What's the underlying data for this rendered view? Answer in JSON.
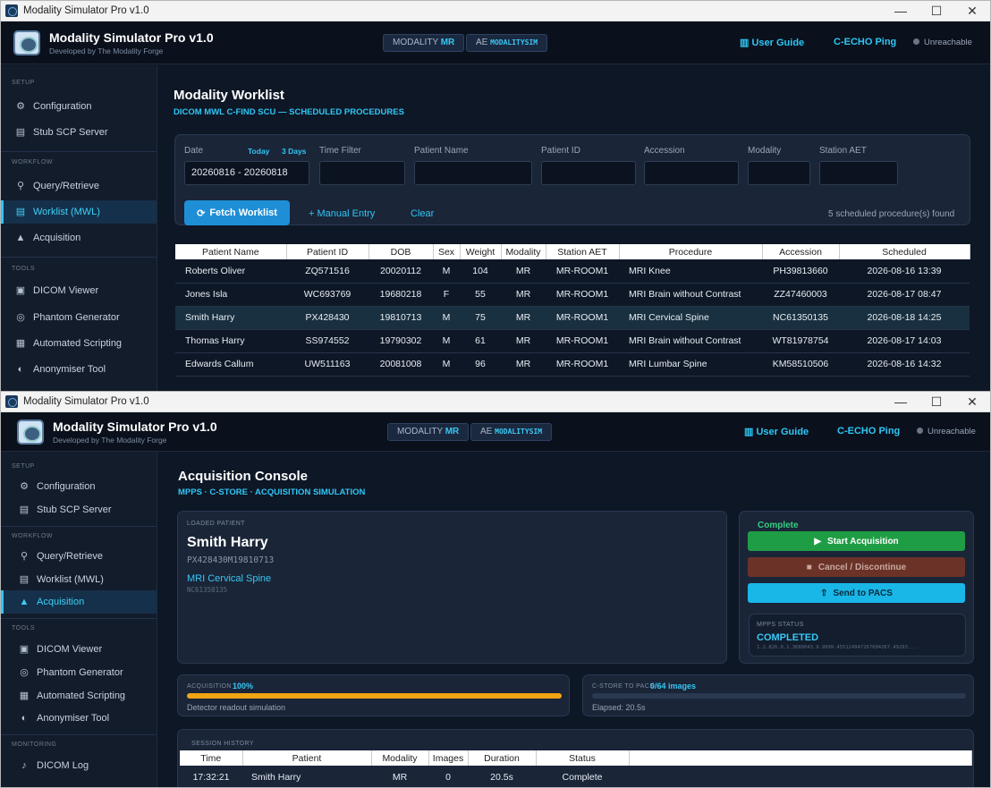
{
  "w1": {
    "title": "Modality Simulator Pro v1.0",
    "app_title": "Modality Simulator Pro v1.0",
    "app_sub": "Developed by The Modality Forge",
    "modality_label": "MODALITY",
    "modality_value": "MR",
    "ae_label": "AE",
    "ae_value": "MODALITYSIM",
    "user_guide": "User Guide",
    "echo": "C-ECHO Ping",
    "status": "Unreachable",
    "nav": {
      "setup": "SETUP",
      "config": "Configuration",
      "stub": "Stub SCP Server",
      "workflow": "WORKFLOW",
      "qr": "Query/Retrieve",
      "worklist": "Worklist (MWL)",
      "acq": "Acquisition",
      "tools": "TOOLS",
      "viewer": "DICOM Viewer",
      "phantom": "Phantom Generator",
      "script": "Automated Scripting",
      "anon": "Anonymiser Tool"
    },
    "page_title": "Modality Worklist",
    "page_sub": "DICOM MWL C-FIND SCU — SCHEDULED PROCEDURES",
    "filters": {
      "date": "Date",
      "today": "Today",
      "three_days": "3 Days",
      "date_value": "20260816 - 20260818",
      "time": "Time Filter",
      "pname": "Patient Name",
      "pid": "Patient ID",
      "acc": "Accession",
      "mod": "Modality",
      "station": "Station AET"
    },
    "fetch": "Fetch Worklist",
    "manual": "+ Manual Entry",
    "clear": "Clear",
    "found": "5 scheduled procedure(s) found",
    "cols": [
      "Patient Name",
      "Patient ID",
      "DOB",
      "Sex",
      "Weight",
      "Modality",
      "Station AET",
      "Procedure",
      "Accession",
      "Scheduled"
    ],
    "rows": [
      [
        "Roberts Oliver",
        "ZQ571516",
        "20020112",
        "M",
        "104",
        "MR",
        "MR-ROOM1",
        "MRI Knee",
        "PH39813660",
        "2026-08-16 13:39"
      ],
      [
        "Jones Isla",
        "WC693769",
        "19680218",
        "F",
        "55",
        "MR",
        "MR-ROOM1",
        "MRI Brain without Contrast",
        "ZZ47460003",
        "2026-08-17 08:47"
      ],
      [
        "Smith Harry",
        "PX428430",
        "19810713",
        "M",
        "75",
        "MR",
        "MR-ROOM1",
        "MRI Cervical Spine",
        "NC61350135",
        "2026-08-18 14:25"
      ],
      [
        "Thomas Harry",
        "SS974552",
        "19790302",
        "M",
        "61",
        "MR",
        "MR-ROOM1",
        "MRI Brain without Contrast",
        "WT81978754",
        "2026-08-17 14:03"
      ],
      [
        "Edwards Callum",
        "UW511163",
        "20081008",
        "M",
        "96",
        "MR",
        "MR-ROOM1",
        "MRI Lumbar Spine",
        "KM58510506",
        "2026-08-16 14:32"
      ]
    ],
    "selected_row": 2
  },
  "w2": {
    "title": "Modality Simulator Pro v1.0",
    "app_title": "Modality Simulator Pro v1.0",
    "app_sub": "Developed by The Modality Forge",
    "modality_label": "MODALITY",
    "modality_value": "MR",
    "ae_label": "AE",
    "ae_value": "MODALITYSIM",
    "user_guide": "User Guide",
    "echo": "C-ECHO Ping",
    "status": "Unreachable",
    "nav": {
      "setup": "SETUP",
      "config": "Configuration",
      "stub": "Stub SCP Server",
      "workflow": "WORKFLOW",
      "qr": "Query/Retrieve",
      "worklist": "Worklist (MWL)",
      "acq": "Acquisition",
      "tools": "TOOLS",
      "viewer": "DICOM Viewer",
      "phantom": "Phantom Generator",
      "script": "Automated Scripting",
      "anon": "Anonymiser Tool",
      "monitoring": "MONITORING",
      "log": "DICOM Log"
    },
    "page_title": "Acquisition Console",
    "page_sub": "MPPS · C-STORE · ACQUISITION SIMULATION",
    "loaded_label": "LOADED PATIENT",
    "patient_name": "Smith Harry",
    "patient_meta": "PX428430M19810713",
    "procedure": "MRI Cervical Spine",
    "accession": "NC61350135",
    "complete_label": "Complete",
    "start": "Start Acquisition",
    "cancel": "Cancel / Discontinue",
    "send": "Send to PACS",
    "mpps_label": "MPPS STATUS",
    "mpps_status": "COMPLETED",
    "mpps_uid": "1.2.826.0.1.3680043.9.9999.455124947267604267.49293...",
    "acq_label": "ACQUISITION",
    "acq_pct": "100%",
    "acq_progress": 1.0,
    "acq_note": "Detector readout simulation",
    "cstore_label": "C-STORE TO PACS",
    "cstore_count": "0/64 images",
    "cstore_progress": 0.0,
    "elapsed": "Elapsed: 20.5s",
    "history_label": "SESSION HISTORY",
    "hist_cols": [
      "Time",
      "Patient",
      "Modality",
      "Images",
      "Duration",
      "Status"
    ],
    "hist_rows": [
      [
        "17:32:21",
        "Smith Harry",
        "MR",
        "0",
        "20.5s",
        "Complete"
      ]
    ]
  },
  "colors": {
    "accent": "#2fc6f5",
    "primary": "#1e8fd6",
    "success": "#1f9d45",
    "danger": "#6b3328",
    "send": "#19b7e8",
    "progress": "#f0a313",
    "bg": "#0e1726"
  }
}
